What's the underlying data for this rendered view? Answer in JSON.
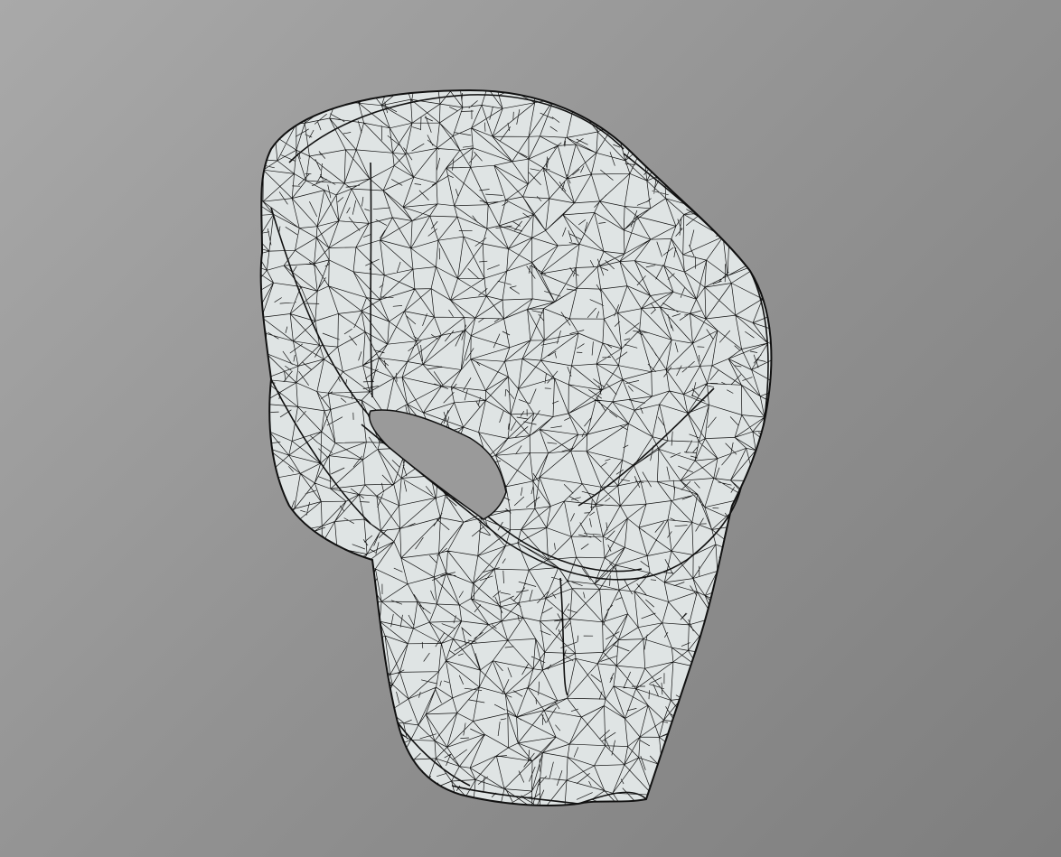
{
  "viewport": {
    "background_top": "#a9a9a9",
    "background_bottom": "#7e7e7e",
    "render_mode": "wireframe-shaded"
  },
  "model": {
    "surface_color": "#dfe4e4",
    "edge_color": "#111111",
    "shadow_color": "#c4caca"
  }
}
